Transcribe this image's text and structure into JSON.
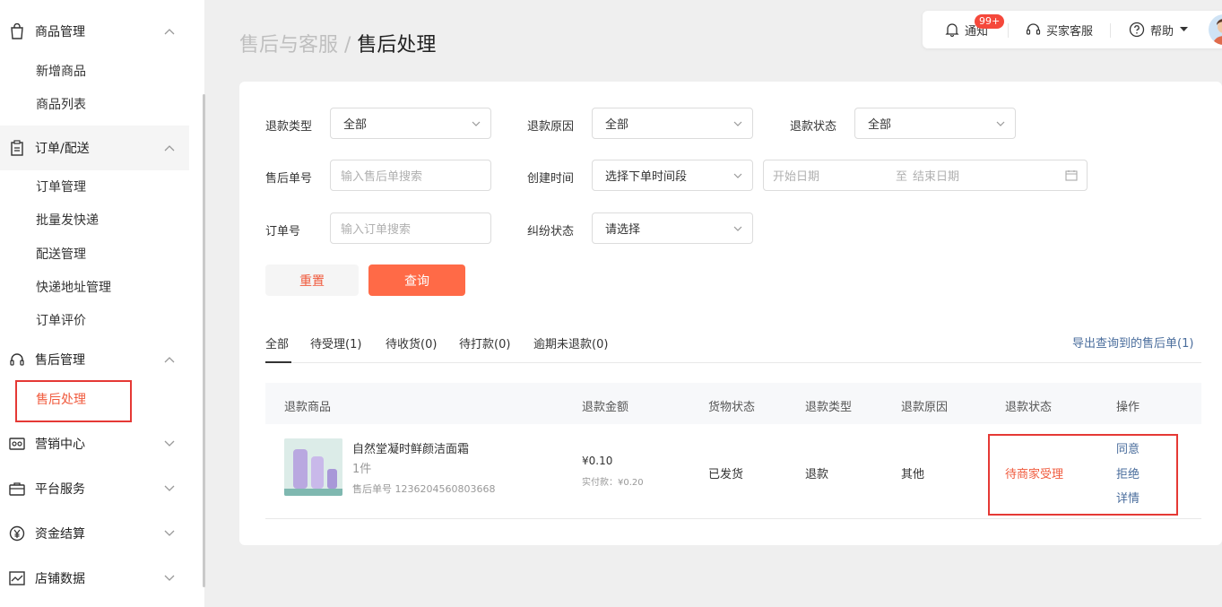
{
  "sidebar": {
    "groups": [
      {
        "label": "商品管理",
        "items": [
          "新增商品",
          "商品列表"
        ]
      },
      {
        "label": "订单/配送",
        "items": [
          "订单管理",
          "批量发快递",
          "配送管理",
          "快递地址管理",
          "订单评价"
        ]
      },
      {
        "label": "售后管理",
        "items": [
          "售后处理"
        ]
      },
      {
        "label": "营销中心"
      },
      {
        "label": "平台服务"
      },
      {
        "label": "资金结算"
      },
      {
        "label": "店铺数据"
      }
    ]
  },
  "breadcrumb": {
    "parent": "售后与客服",
    "sep": " / ",
    "current": "售后处理"
  },
  "topbar": {
    "notice": "通知",
    "badge": "99+",
    "service": "买家客服",
    "help": "帮助"
  },
  "filters": {
    "refund_type": {
      "label": "退款类型",
      "value": "全部"
    },
    "refund_reason": {
      "label": "退款原因",
      "value": "全部"
    },
    "refund_status": {
      "label": "退款状态",
      "value": "全部"
    },
    "after_no": {
      "label": "售后单号",
      "placeholder": "输入售后单搜索"
    },
    "create_time": {
      "label": "创建时间",
      "value": "选择下单时间段",
      "start": "开始日期",
      "to": "至",
      "end": "结束日期"
    },
    "order_no": {
      "label": "订单号",
      "placeholder": "输入订单搜索"
    },
    "dispute": {
      "label": "纠纷状态",
      "value": "请选择"
    }
  },
  "buttons": {
    "reset": "重置",
    "query": "查询"
  },
  "tabs": [
    "全部",
    "待受理(1)",
    "待收货(0)",
    "待打款(0)",
    "逾期未退款(0)"
  ],
  "export": "导出查询到的售后单(1)",
  "table": {
    "headers": [
      "退款商品",
      "退款金额",
      "货物状态",
      "退款类型",
      "退款原因",
      "退款状态",
      "操作"
    ],
    "row": {
      "name": "自然堂凝时鲜颜洁面霜",
      "qty": "1件",
      "after_no": "售后单号 1236204560803668",
      "amount": "¥0.10",
      "paid": "实付款：¥0.20",
      "goods_status": "已发货",
      "refund_type": "退款",
      "reason": "其他",
      "status": "待商家受理",
      "ops": [
        "同意",
        "拒绝",
        "详情"
      ]
    }
  },
  "colors": {
    "accent": "#ff6a47",
    "link": "#4a6d9c",
    "status": "#f05a3d"
  }
}
